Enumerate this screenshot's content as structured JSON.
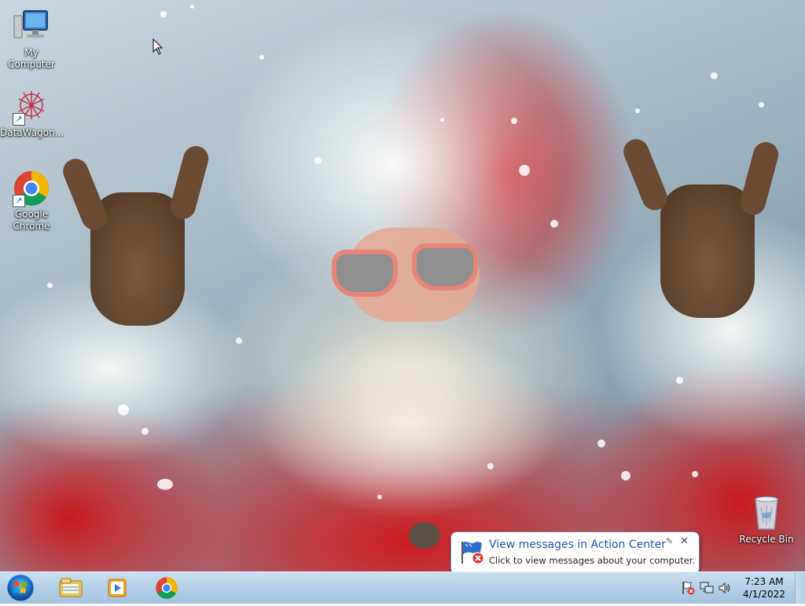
{
  "desktop": {
    "icons": [
      {
        "label": "My Computer",
        "icon": "computer-icon"
      },
      {
        "label": "DataWagon...",
        "icon": "datawagon-icon"
      },
      {
        "label": "Google Chrome",
        "icon": "chrome-icon"
      },
      {
        "label": "Recycle Bin",
        "icon": "recycle-bin-icon"
      }
    ]
  },
  "taskbar": {
    "pinned": [
      {
        "name": "Windows Explorer",
        "icon": "folder-icon"
      },
      {
        "name": "Windows Media Player",
        "icon": "media-player-icon"
      },
      {
        "name": "Google Chrome",
        "icon": "chrome-icon"
      }
    ],
    "tray": {
      "icons": [
        "action-center-icon",
        "network-icon",
        "volume-icon"
      ],
      "time": "7:23 AM",
      "date": "4/1/2022"
    }
  },
  "notification": {
    "title": "View messages in Action Center",
    "body": "Click to view messages about your computer.",
    "close": "✕",
    "pin": "✎"
  },
  "colors": {
    "balloon_title": "#1a56b8",
    "taskbar": "#b0cce6"
  }
}
